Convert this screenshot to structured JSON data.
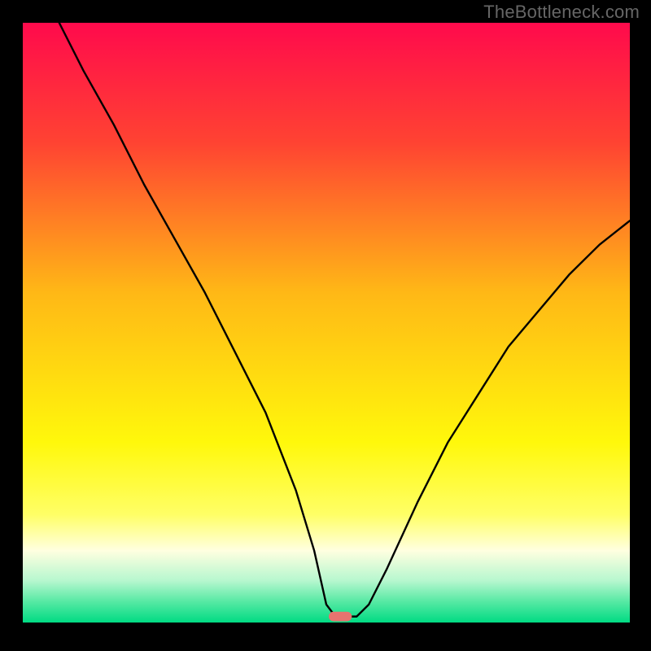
{
  "watermark": "TheBottleneck.com",
  "chart_data": {
    "type": "line",
    "title": "",
    "xlabel": "",
    "ylabel": "",
    "xlim": [
      0,
      100
    ],
    "ylim": [
      0,
      100
    ],
    "grid": false,
    "legend": null,
    "background": {
      "type": "vertical-gradient",
      "stops": [
        {
          "pos": 0.0,
          "color": "#ff0a4c"
        },
        {
          "pos": 0.2,
          "color": "#ff4332"
        },
        {
          "pos": 0.45,
          "color": "#ffb816"
        },
        {
          "pos": 0.7,
          "color": "#fff80b"
        },
        {
          "pos": 0.82,
          "color": "#ffff66"
        },
        {
          "pos": 0.88,
          "color": "#ffffe0"
        },
        {
          "pos": 0.93,
          "color": "#b7f7cf"
        },
        {
          "pos": 0.965,
          "color": "#57e9a4"
        },
        {
          "pos": 1.0,
          "color": "#00db83"
        }
      ]
    },
    "series": [
      {
        "name": "curve",
        "stroke": "#000000",
        "x": [
          6,
          10,
          15,
          20,
          25,
          30,
          35,
          40,
          45,
          48,
          50,
          51.5,
          53,
          55,
          57,
          60,
          65,
          70,
          75,
          80,
          85,
          90,
          95,
          100
        ],
        "y": [
          100,
          92,
          83,
          73,
          64,
          55,
          45,
          35,
          22,
          12,
          3,
          1,
          1,
          1,
          3,
          9,
          20,
          30,
          38,
          46,
          52,
          58,
          63,
          67
        ]
      }
    ],
    "marker": {
      "name": "optimal-point",
      "shape": "rounded-bar",
      "x": 52.3,
      "y": 1.0,
      "width_x_units": 3.8,
      "height_y_units": 1.6,
      "fill": "#e6736f"
    }
  }
}
